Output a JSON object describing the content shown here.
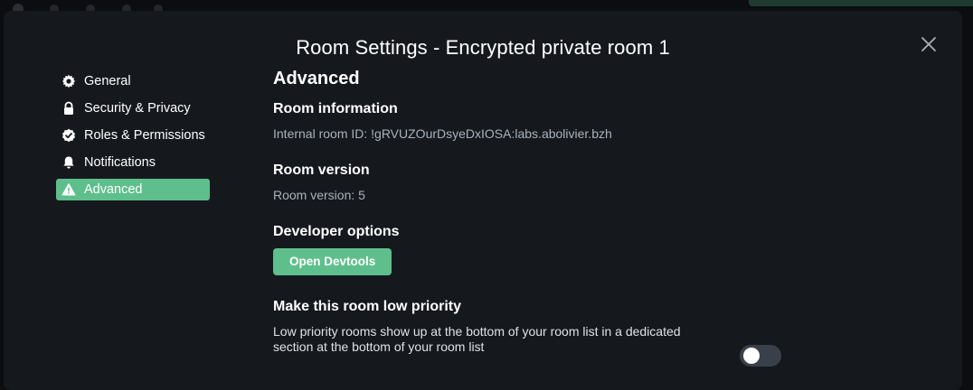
{
  "dialog": {
    "title": "Room Settings - Encrypted private room 1"
  },
  "sidebar": {
    "items": [
      {
        "label": "General",
        "icon": "gear-icon"
      },
      {
        "label": "Security & Privacy",
        "icon": "lock-icon"
      },
      {
        "label": "Roles & Permissions",
        "icon": "badge-check-icon"
      },
      {
        "label": "Notifications",
        "icon": "bell-icon"
      },
      {
        "label": "Advanced",
        "icon": "warning-icon",
        "active": true
      }
    ]
  },
  "advanced": {
    "heading": "Advanced",
    "room_info_heading": "Room information",
    "room_id_text": "Internal room ID: !gRVUZOurDsyeDxIOSA:labs.abolivier.bzh",
    "room_version_heading": "Room version",
    "room_version_text": "Room version: 5",
    "developer_heading": "Developer options",
    "devtools_button": "Open Devtools",
    "low_priority_heading": "Make this room low priority",
    "low_priority_desc": "Low priority rooms show up at the bottom of your room list in a dedicated section at the bottom of your room list",
    "low_priority_enabled": false
  },
  "colors": {
    "accent": "#5fbf8c",
    "dialog_bg": "#15191e",
    "page_bg": "#0b0d10"
  }
}
